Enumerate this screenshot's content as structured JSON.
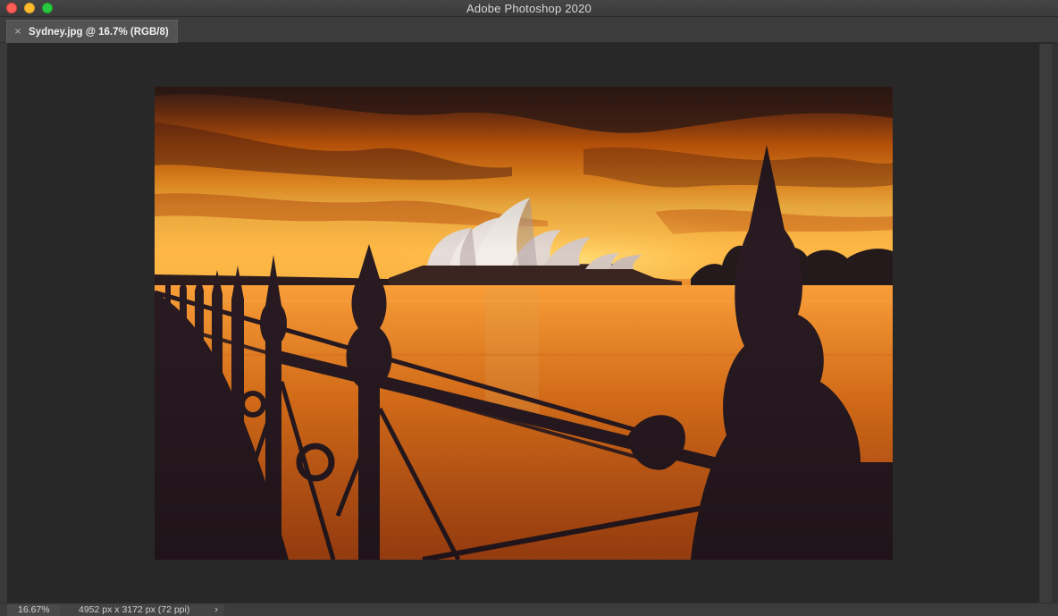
{
  "window": {
    "title": "Adobe Photoshop 2020",
    "traffic_lights": [
      "close",
      "minimize",
      "zoom"
    ]
  },
  "document_tab": {
    "close_glyph": "×",
    "label": "Sydney.jpg @ 16.7% (RGB/8)"
  },
  "canvas": {
    "image_subject": "sydney-opera-house-sunset-photo",
    "colors": {
      "sky_top": "#5a3220",
      "sky_mid": "#f07a12",
      "horizon": "#ffb840",
      "water": "#e87418",
      "silhouette": "#2a1a22"
    }
  },
  "status": {
    "zoom": "16.67%",
    "doc_info": "4952 px x 3172 px (72 ppi)",
    "menu_glyph": "›"
  }
}
